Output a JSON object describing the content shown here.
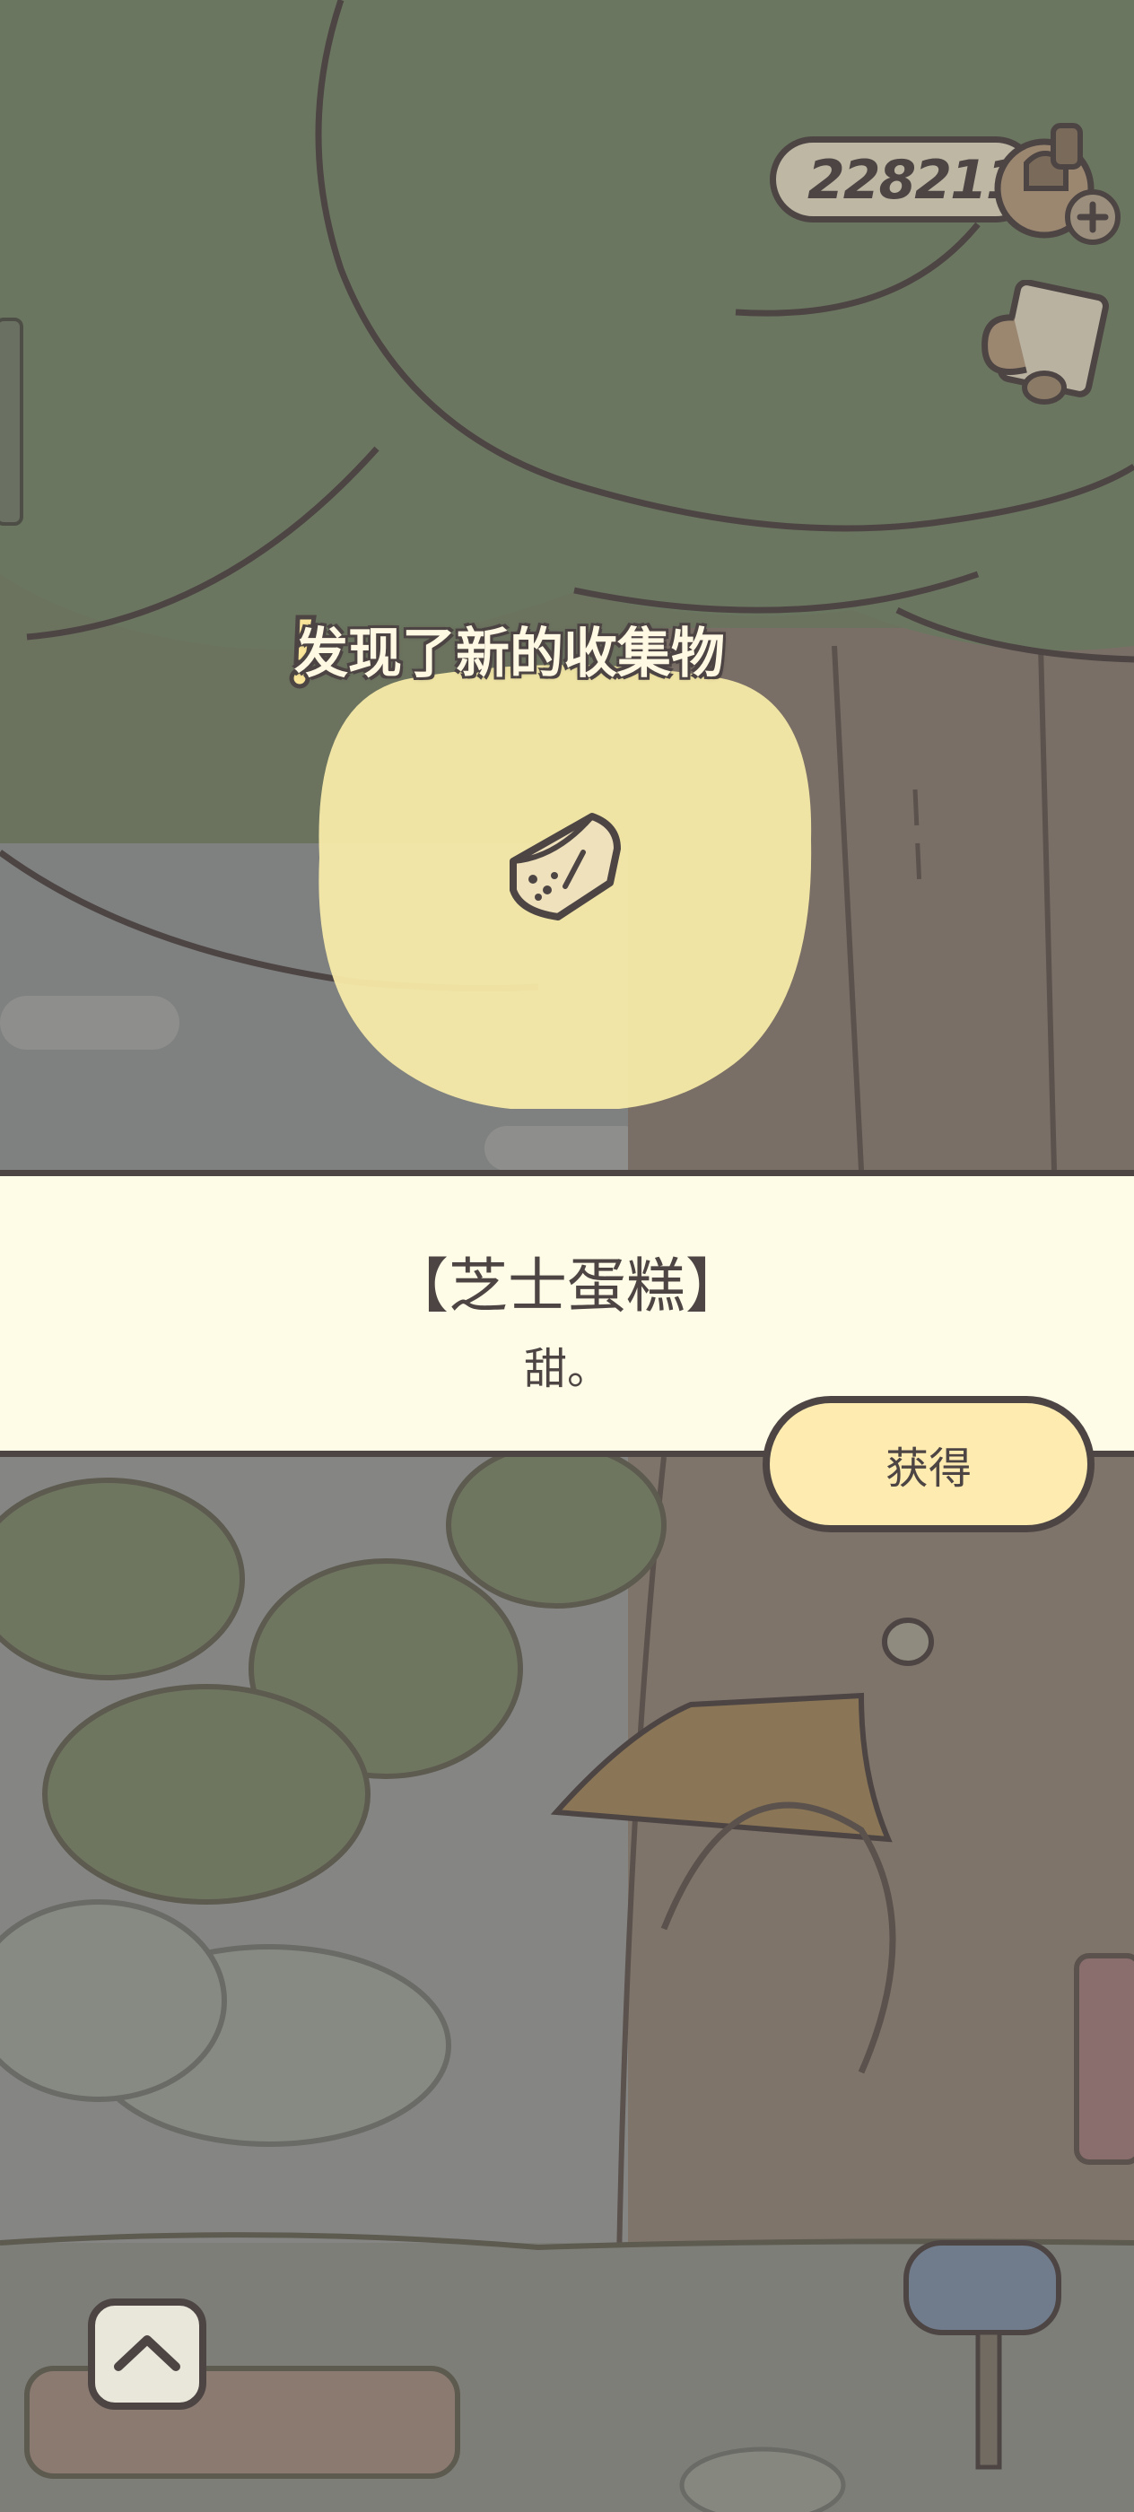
{
  "hud": {
    "currency_value": "228211",
    "currency_icon": "clover-acorn-icon",
    "add_icon": "plus-icon",
    "tool_icon": "mug-icon"
  },
  "discovery": {
    "headline": "发现了新的收集物",
    "icon": "exclamation-icon"
  },
  "item": {
    "name": "【芝士蛋糕】",
    "description": "甜。",
    "icon": "cheesecake-icon"
  },
  "actions": {
    "obtain_label": "获得",
    "scroll_up_icon": "chevron-up-icon"
  },
  "colors": {
    "outline": "#4d4544",
    "panel": "#fefce6",
    "button": "#fdebb0",
    "glow": "#f7eaa8"
  }
}
